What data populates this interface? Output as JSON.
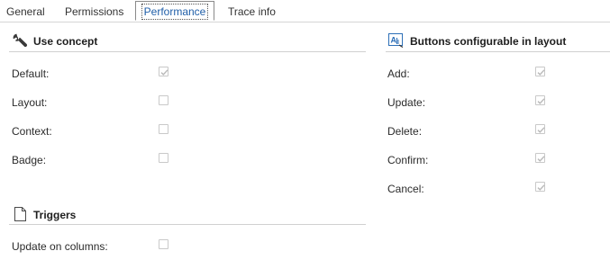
{
  "tabs": [
    {
      "label": "General",
      "active": false
    },
    {
      "label": "Permissions",
      "active": false
    },
    {
      "label": "Performance",
      "active": true
    },
    {
      "label": "Trace info",
      "active": false
    }
  ],
  "use_concept": {
    "title": "Use concept",
    "icon": "wrench-icon",
    "rows": [
      {
        "label": "Default:",
        "checked": true,
        "disabled": true
      },
      {
        "label": "Layout:",
        "checked": false,
        "disabled": true
      },
      {
        "label": "Context:",
        "checked": false,
        "disabled": true
      },
      {
        "label": "Badge:",
        "checked": false,
        "disabled": true
      }
    ]
  },
  "triggers": {
    "title": "Triggers",
    "icon": "document-icon",
    "rows": [
      {
        "label": "Update on columns:",
        "checked": false,
        "disabled": true
      }
    ]
  },
  "buttons_configurable": {
    "title": "Buttons configurable in layout",
    "icon": "layout-text-icon",
    "rows": [
      {
        "label": "Add:",
        "checked": true,
        "disabled": true
      },
      {
        "label": "Update:",
        "checked": true,
        "disabled": true
      },
      {
        "label": "Delete:",
        "checked": true,
        "disabled": true
      },
      {
        "label": "Confirm:",
        "checked": true,
        "disabled": true
      },
      {
        "label": "Cancel:",
        "checked": true,
        "disabled": true
      }
    ]
  },
  "colors": {
    "active_tab_text": "#1f5ea8",
    "check_mark": "#b8b8b8",
    "icon_blue": "#2d6fb7"
  }
}
